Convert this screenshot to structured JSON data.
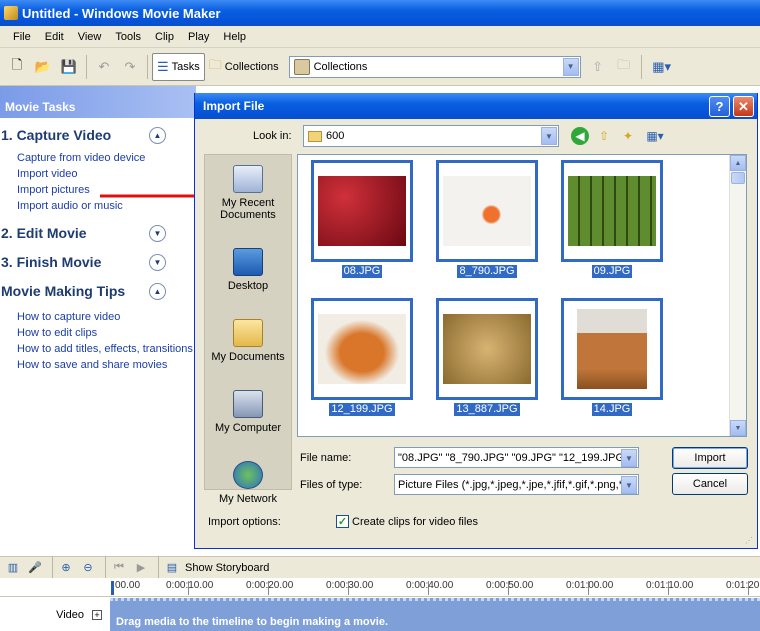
{
  "window": {
    "title": "Untitled - Windows Movie Maker"
  },
  "menu": [
    "File",
    "Edit",
    "View",
    "Tools",
    "Clip",
    "Play",
    "Help"
  ],
  "toolbar": {
    "tasks_label": "Tasks",
    "collections_label": "Collections",
    "collections_select": "Collections"
  },
  "taskpane": {
    "header": "Movie Tasks",
    "sections": [
      {
        "title": "1. Capture Video",
        "links": [
          "Capture from video device",
          "Import video",
          "Import pictures",
          "Import audio or music"
        ]
      },
      {
        "title": "2. Edit Movie",
        "links": []
      },
      {
        "title": "3. Finish Movie",
        "links": []
      },
      {
        "title": "Movie Making Tips",
        "links": [
          "How to capture video",
          "How to edit clips",
          "How to add titles, effects, transitions",
          "How to save and share movies"
        ]
      }
    ]
  },
  "dialog": {
    "title": "Import File",
    "help_label": "?",
    "close_label": "✕",
    "look_in_label": "Look in:",
    "look_in_value": "600",
    "places": [
      "My Recent Documents",
      "Desktop",
      "My Documents",
      "My Computer",
      "My Network"
    ],
    "files": [
      {
        "name": "08.JPG",
        "color": "#8a1020"
      },
      {
        "name": "8_790.JPG",
        "color": "#e8643a"
      },
      {
        "name": "09.JPG",
        "color": "#4f7a26"
      },
      {
        "name": "12_199.JPG",
        "color": "#d77a2e"
      },
      {
        "name": "13_887.JPG",
        "color": "#c9a25a"
      },
      {
        "name": "14.JPG",
        "color": "#b8702e"
      }
    ],
    "file_name_label": "File name:",
    "file_name_value": "\"08.JPG\" \"8_790.JPG\" \"09.JPG\" \"12_199.JPG\"",
    "files_of_type_label": "Files of type:",
    "files_of_type_value": "Picture Files (*.jpg,*.jpeg,*.jpe,*.jfif,*.gif,*.png,*.b",
    "import_button": "Import",
    "cancel_button": "Cancel",
    "import_options_label": "Import options:",
    "create_clips_label": "Create clips for video files",
    "create_clips_checked": true
  },
  "timeline": {
    "show_storyboard": "Show Storyboard",
    "ticks": [
      "00.00",
      "0:00:10.00",
      "0:00:20.00",
      "0:00:30.00",
      "0:00:40.00",
      "0:00:50.00",
      "0:01:00.00",
      "0:01:10.00",
      "0:01:20"
    ],
    "track_label": "Video",
    "track_hint": "Drag media to the timeline to begin making a movie."
  }
}
